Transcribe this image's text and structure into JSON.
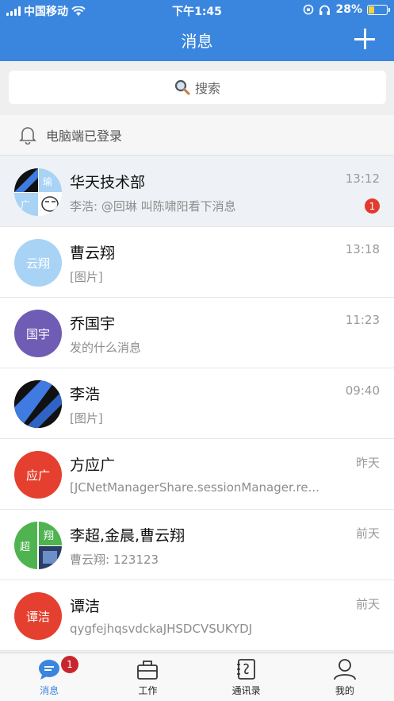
{
  "status_bar": {
    "carrier": "中国移动",
    "time": "下午1:45",
    "battery": "28%",
    "battery_level": 0.28
  },
  "header": {
    "title": "消息"
  },
  "search": {
    "placeholder": "搜索"
  },
  "login_notice": "电脑端已登录",
  "conversations": [
    {
      "name": "华天技术部",
      "preview": "李浩: @回琳 叫陈啸阳看下消息",
      "time": "13:12",
      "unread": "1",
      "avatar_texts": [
        "瑜",
        "广"
      ]
    },
    {
      "name": "曹云翔",
      "preview": "[图片]",
      "time": "13:18",
      "avatar_text": "云翔",
      "avatar_color": "#a9d3f5"
    },
    {
      "name": "乔国宇",
      "preview": "发的什么消息",
      "time": "11:23",
      "avatar_text": "国宇",
      "avatar_color": "#6f5db5"
    },
    {
      "name": "李浩",
      "preview": "[图片]",
      "time": "09:40"
    },
    {
      "name": "方应广",
      "preview": "[JCNetManagerShare.sessionManager.re...",
      "time": "昨天",
      "avatar_text": "应广",
      "avatar_color": "#e5402f"
    },
    {
      "name": "李超,金晨,曹云翔",
      "preview": "曹云翔: 123123",
      "time": "前天",
      "avatar_texts": [
        "超",
        "翔"
      ]
    },
    {
      "name": "谭洁",
      "preview": "qygfejhqsvdckaJHSDCVSUKYDJ",
      "time": "前天",
      "avatar_text": "谭洁",
      "avatar_color": "#e5402f"
    }
  ],
  "tabbar": {
    "items": [
      {
        "label": "消息",
        "badge": "1"
      },
      {
        "label": "工作"
      },
      {
        "label": "通讯录"
      },
      {
        "label": "我的"
      }
    ]
  },
  "colors": {
    "brand": "#3a86df",
    "badge": "#e23a2e"
  }
}
